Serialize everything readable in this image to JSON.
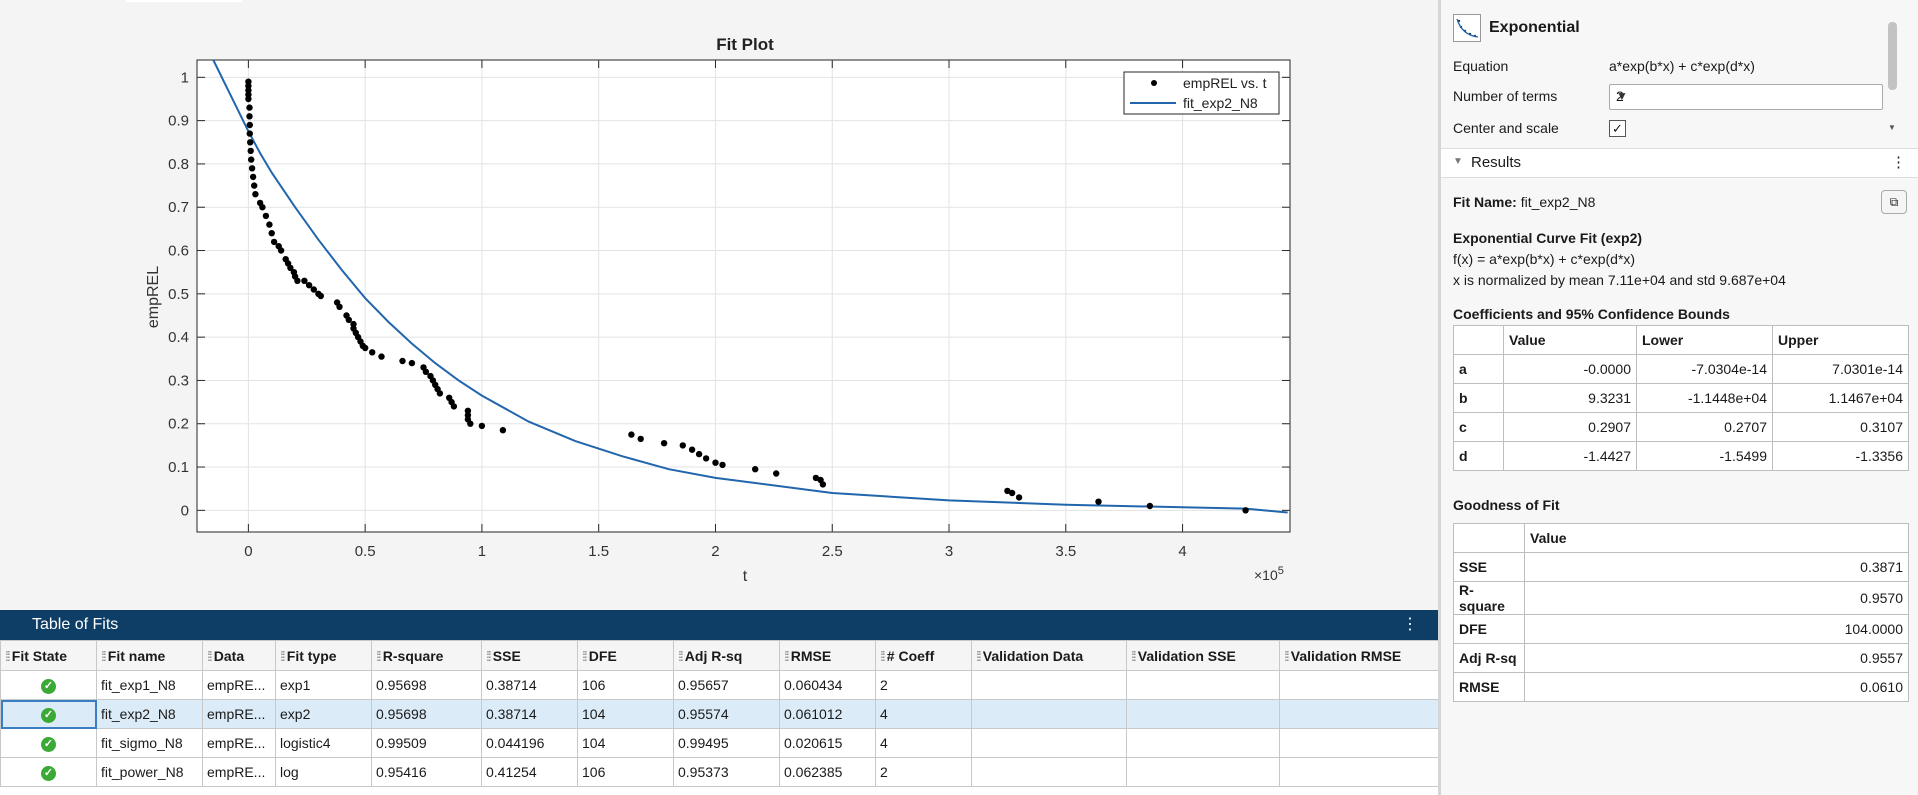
{
  "plot": {
    "title": "Fit Plot",
    "xlabel": "t",
    "ylabel": "empREL",
    "x_exponent": "×10",
    "x_exponent_power": "5",
    "xticks": [
      "0",
      "0.5",
      "1",
      "1.5",
      "2",
      "2.5",
      "3",
      "3.5",
      "4"
    ],
    "yticks": [
      "0",
      "0.1",
      "0.2",
      "0.3",
      "0.4",
      "0.5",
      "0.6",
      "0.7",
      "0.8",
      "0.9",
      "1"
    ],
    "legend": [
      "empREL vs. t",
      "fit_exp2_N8"
    ]
  },
  "chart_data": {
    "type": "scatter",
    "title": "Fit Plot",
    "xlabel": "t",
    "ylabel": "empREL",
    "x_scale_factor": 100000,
    "xlim": [
      -0.22,
      4.46
    ],
    "ylim": [
      -0.05,
      1.04
    ],
    "grid": true,
    "legend_position": "top-right",
    "colors": {
      "points": "#000000",
      "fit": "#2166ac"
    },
    "series": [
      {
        "name": "empREL vs. t",
        "type": "scatter",
        "points": [
          [
            0,
            0.99
          ],
          [
            0,
            0.98
          ],
          [
            0,
            0.97
          ],
          [
            0,
            0.96
          ],
          [
            0,
            0.95
          ],
          [
            0.005,
            0.93
          ],
          [
            0.005,
            0.91
          ],
          [
            0.006,
            0.89
          ],
          [
            0.006,
            0.87
          ],
          [
            0.008,
            0.85
          ],
          [
            0.01,
            0.83
          ],
          [
            0.012,
            0.81
          ],
          [
            0.016,
            0.79
          ],
          [
            0.02,
            0.77
          ],
          [
            0.025,
            0.75
          ],
          [
            0.03,
            0.73
          ],
          [
            0.05,
            0.71
          ],
          [
            0.06,
            0.7
          ],
          [
            0.075,
            0.68
          ],
          [
            0.09,
            0.66
          ],
          [
            0.1,
            0.64
          ],
          [
            0.11,
            0.62
          ],
          [
            0.13,
            0.61
          ],
          [
            0.14,
            0.6
          ],
          [
            0.16,
            0.58
          ],
          [
            0.17,
            0.57
          ],
          [
            0.18,
            0.56
          ],
          [
            0.195,
            0.55
          ],
          [
            0.2,
            0.54
          ],
          [
            0.21,
            0.53
          ],
          [
            0.24,
            0.53
          ],
          [
            0.26,
            0.52
          ],
          [
            0.28,
            0.51
          ],
          [
            0.3,
            0.5
          ],
          [
            0.31,
            0.495
          ],
          [
            0.38,
            0.48
          ],
          [
            0.39,
            0.47
          ],
          [
            0.42,
            0.45
          ],
          [
            0.43,
            0.44
          ],
          [
            0.45,
            0.43
          ],
          [
            0.45,
            0.42
          ],
          [
            0.46,
            0.41
          ],
          [
            0.47,
            0.4
          ],
          [
            0.48,
            0.39
          ],
          [
            0.49,
            0.38
          ],
          [
            0.5,
            0.375
          ],
          [
            0.53,
            0.365
          ],
          [
            0.57,
            0.355
          ],
          [
            0.66,
            0.345
          ],
          [
            0.7,
            0.34
          ],
          [
            0.75,
            0.33
          ],
          [
            0.76,
            0.32
          ],
          [
            0.78,
            0.31
          ],
          [
            0.79,
            0.3
          ],
          [
            0.8,
            0.29
          ],
          [
            0.81,
            0.28
          ],
          [
            0.82,
            0.27
          ],
          [
            0.86,
            0.26
          ],
          [
            0.87,
            0.25
          ],
          [
            0.88,
            0.24
          ],
          [
            0.94,
            0.23
          ],
          [
            0.94,
            0.22
          ],
          [
            0.94,
            0.21
          ],
          [
            0.95,
            0.2
          ],
          [
            1.0,
            0.195
          ],
          [
            1.09,
            0.185
          ],
          [
            1.64,
            0.175
          ],
          [
            1.68,
            0.165
          ],
          [
            1.78,
            0.155
          ],
          [
            1.86,
            0.15
          ],
          [
            1.9,
            0.14
          ],
          [
            1.93,
            0.13
          ],
          [
            1.96,
            0.12
          ],
          [
            2.0,
            0.11
          ],
          [
            2.03,
            0.105
          ],
          [
            2.17,
            0.095
          ],
          [
            2.26,
            0.085
          ],
          [
            2.43,
            0.075
          ],
          [
            2.45,
            0.07
          ],
          [
            2.46,
            0.06
          ],
          [
            3.25,
            0.045
          ],
          [
            3.27,
            0.04
          ],
          [
            3.3,
            0.03
          ],
          [
            3.64,
            0.02
          ],
          [
            3.86,
            0.01
          ],
          [
            4.27,
            0.0
          ]
        ]
      },
      {
        "name": "fit_exp2_N8",
        "type": "line",
        "function": "a*exp(b*x) + c*exp(d*x)",
        "x": [
          -0.15,
          -0.1,
          -0.05,
          0,
          0.05,
          0.1,
          0.2,
          0.3,
          0.4,
          0.5,
          0.6,
          0.7,
          0.8,
          0.9,
          1.0,
          1.2,
          1.4,
          1.6,
          1.8,
          2.0,
          2.5,
          3.0,
          3.5,
          4.0,
          4.27,
          4.45
        ],
        "y": [
          1.04,
          0.985,
          0.93,
          0.875,
          0.825,
          0.78,
          0.7,
          0.625,
          0.555,
          0.49,
          0.435,
          0.385,
          0.34,
          0.3,
          0.265,
          0.205,
          0.16,
          0.125,
          0.095,
          0.075,
          0.04,
          0.023,
          0.013,
          0.007,
          0.004,
          -0.005
        ]
      }
    ]
  },
  "tof": {
    "title": "Table of Fits",
    "kebab": "⋮",
    "columns": [
      "Fit State",
      "Fit name",
      "Data",
      "Fit type",
      "R-square",
      "SSE",
      "DFE",
      "Adj R-sq",
      "RMSE",
      "# Coeff",
      "Validation Data",
      "Validation SSE",
      "Validation RMSE"
    ],
    "rows": [
      {
        "name": "fit_exp1_N8",
        "data": "empRE...",
        "type": "exp1",
        "rsq": "0.95698",
        "sse": "0.38714",
        "dfe": "106",
        "adj": "0.95657",
        "rmse": "0.060434",
        "coeff": "2",
        "vdata": "",
        "vsse": "",
        "vrmse": ""
      },
      {
        "name": "fit_exp2_N8",
        "data": "empRE...",
        "type": "exp2",
        "rsq": "0.95698",
        "sse": "0.38714",
        "dfe": "104",
        "adj": "0.95574",
        "rmse": "0.061012",
        "coeff": "4",
        "vdata": "",
        "vsse": "",
        "vrmse": ""
      },
      {
        "name": "fit_sigmo_N8",
        "data": "empRE...",
        "type": "logistic4",
        "rsq": "0.99509",
        "sse": "0.044196",
        "dfe": "104",
        "adj": "0.99495",
        "rmse": "0.020615",
        "coeff": "4",
        "vdata": "",
        "vsse": "",
        "vrmse": ""
      },
      {
        "name": "fit_power_N8",
        "data": "empRE...",
        "type": "log",
        "rsq": "0.95416",
        "sse": "0.41254",
        "dfe": "106",
        "adj": "0.95373",
        "rmse": "0.062385",
        "coeff": "2",
        "vdata": "",
        "vsse": "",
        "vrmse": ""
      }
    ]
  },
  "fit_options": {
    "model": "Exponential",
    "equation_label": "Equation",
    "equation": "a*exp(b*x) + c*exp(d*x)",
    "terms_label": "Number of terms",
    "terms_value": "2",
    "center_label": "Center and scale",
    "center_checked": "✓"
  },
  "results": {
    "header": "Results",
    "kebab": "⋮",
    "fit_name_label": "Fit Name:",
    "fit_name": "fit_exp2_N8",
    "curve_title": "Exponential Curve Fit (exp2)",
    "formula": "f(x) = a*exp(b*x) + c*exp(d*x)",
    "normalization": "x is normalized by mean 7.11e+04 and std 9.687e+04",
    "coef_title": "Coefficients and 95% Confidence Bounds",
    "coef_cols": [
      "Value",
      "Lower",
      "Upper"
    ],
    "coefs": [
      {
        "name": "a",
        "value": "-0.0000",
        "lower": "-7.0304e-14",
        "upper": "7.0301e-14"
      },
      {
        "name": "b",
        "value": "9.3231",
        "lower": "-1.1448e+04",
        "upper": "1.1467e+04"
      },
      {
        "name": "c",
        "value": "0.2907",
        "lower": "0.2707",
        "upper": "0.3107"
      },
      {
        "name": "d",
        "value": "-1.4427",
        "lower": "-1.5499",
        "upper": "-1.3356"
      }
    ],
    "gof_title": "Goodness of Fit",
    "gof_col": "Value",
    "gof": [
      {
        "name": "SSE",
        "value": "0.3871"
      },
      {
        "name": "R-square",
        "value": "0.9570"
      },
      {
        "name": "DFE",
        "value": "104.0000"
      },
      {
        "name": "Adj R-sq",
        "value": "0.9557"
      },
      {
        "name": "RMSE",
        "value": "0.0610"
      }
    ]
  }
}
